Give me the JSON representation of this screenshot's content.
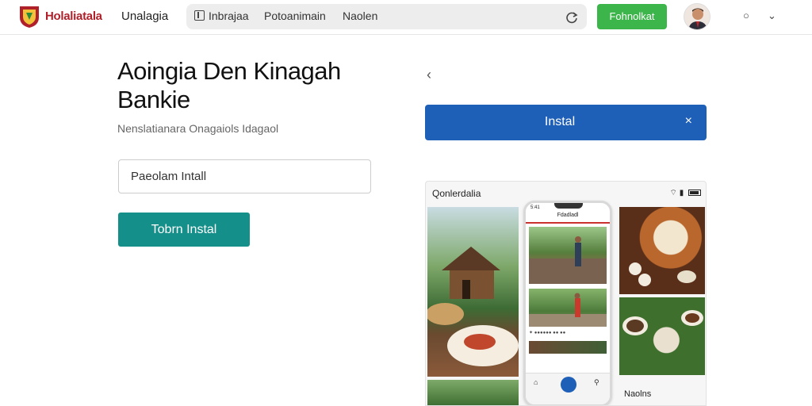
{
  "header": {
    "brand": "Holaliatala",
    "nav_link": "Unalagia",
    "address_items": [
      "Inbrajaa",
      "Potoanimain",
      "Naolen"
    ],
    "install_button": "Fohnolkat"
  },
  "hero": {
    "title": "Aoingia Den Kinagah Bankie",
    "subtitle": "Nenslatianara Onagaiols Idagaol",
    "input_value": "Paeolam Intall",
    "button": "Tobrn Instal"
  },
  "install_banner": {
    "label": "Instal",
    "close": "×"
  },
  "preview": {
    "title": "Qonlerdalia",
    "phone_header": "Fdadladl",
    "phone_row": "✦ ●●●●●● ●● ●●",
    "right_caption": "Naolns"
  },
  "colors": {
    "brand_red": "#b0202a",
    "green_button": "#3cb54a",
    "teal_button": "#158f8a",
    "blue_banner": "#1e5fb8"
  }
}
